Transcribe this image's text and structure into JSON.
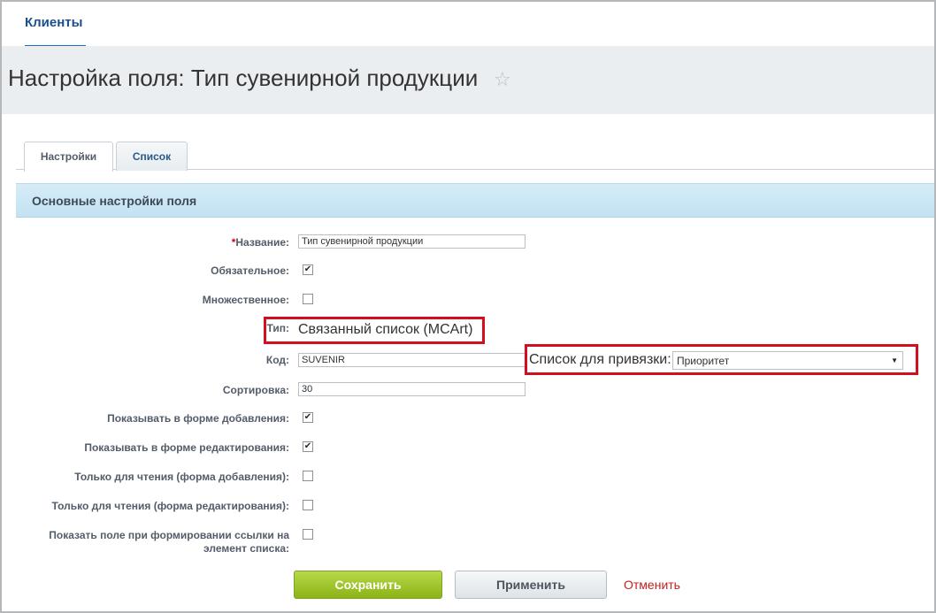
{
  "nav": {
    "link": "Клиенты"
  },
  "page": {
    "title": "Настройка поля: Тип сувенирной продукции",
    "star": "☆"
  },
  "tabs": [
    {
      "label": "Настройки",
      "active": true
    },
    {
      "label": "Список",
      "active": false
    }
  ],
  "section": {
    "title": "Основные настройки поля"
  },
  "form": {
    "name": {
      "required_mark": "*",
      "label": "Название:",
      "value": "Тип сувенирной продукции"
    },
    "mandatory": {
      "label": "Обязательное:",
      "checked": true
    },
    "multiple": {
      "label": "Множественное:",
      "checked": false
    },
    "type": {
      "label": "Тип:",
      "value": "Связанный список (MCArt)"
    },
    "code": {
      "label": "Код:",
      "value": "SUVENIR"
    },
    "binding": {
      "label": "Список для привязки:",
      "selected": "Приоритет"
    },
    "sort": {
      "label": "Сортировка:",
      "value": "30"
    },
    "show_add": {
      "label": "Показывать в форме добавления:",
      "checked": true
    },
    "show_edit": {
      "label": "Показывать в форме редактирования:",
      "checked": true
    },
    "ro_add": {
      "label": "Только для чтения (форма добавления):",
      "checked": false
    },
    "ro_edit": {
      "label": "Только для чтения (форма редактирования):",
      "checked": false
    },
    "show_link": {
      "label_line1": "Показать поле при формировании ссылки на",
      "label_line2": "элемент списка:",
      "checked": false
    }
  },
  "buttons": {
    "save": "Сохранить",
    "apply": "Применить",
    "cancel": "Отменить"
  },
  "colors": {
    "nav_link": "#1a4f8b",
    "highlight_box": "#d10f1d",
    "save_button": "#8cb316",
    "cancel_link": "#c0211e"
  }
}
